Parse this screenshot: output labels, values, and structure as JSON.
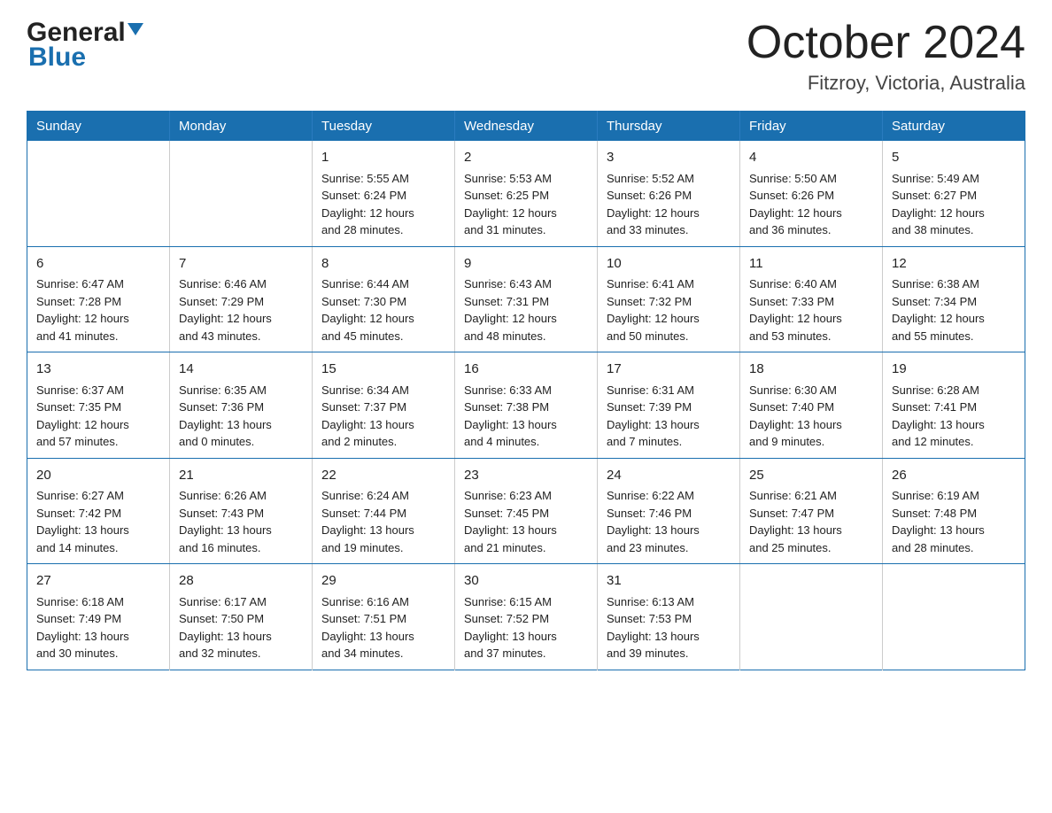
{
  "header": {
    "logo_general": "General",
    "logo_blue": "Blue",
    "month_title": "October 2024",
    "location": "Fitzroy, Victoria, Australia"
  },
  "weekdays": [
    "Sunday",
    "Monday",
    "Tuesday",
    "Wednesday",
    "Thursday",
    "Friday",
    "Saturday"
  ],
  "weeks": [
    [
      {
        "day": "",
        "info": ""
      },
      {
        "day": "",
        "info": ""
      },
      {
        "day": "1",
        "info": "Sunrise: 5:55 AM\nSunset: 6:24 PM\nDaylight: 12 hours\nand 28 minutes."
      },
      {
        "day": "2",
        "info": "Sunrise: 5:53 AM\nSunset: 6:25 PM\nDaylight: 12 hours\nand 31 minutes."
      },
      {
        "day": "3",
        "info": "Sunrise: 5:52 AM\nSunset: 6:26 PM\nDaylight: 12 hours\nand 33 minutes."
      },
      {
        "day": "4",
        "info": "Sunrise: 5:50 AM\nSunset: 6:26 PM\nDaylight: 12 hours\nand 36 minutes."
      },
      {
        "day": "5",
        "info": "Sunrise: 5:49 AM\nSunset: 6:27 PM\nDaylight: 12 hours\nand 38 minutes."
      }
    ],
    [
      {
        "day": "6",
        "info": "Sunrise: 6:47 AM\nSunset: 7:28 PM\nDaylight: 12 hours\nand 41 minutes."
      },
      {
        "day": "7",
        "info": "Sunrise: 6:46 AM\nSunset: 7:29 PM\nDaylight: 12 hours\nand 43 minutes."
      },
      {
        "day": "8",
        "info": "Sunrise: 6:44 AM\nSunset: 7:30 PM\nDaylight: 12 hours\nand 45 minutes."
      },
      {
        "day": "9",
        "info": "Sunrise: 6:43 AM\nSunset: 7:31 PM\nDaylight: 12 hours\nand 48 minutes."
      },
      {
        "day": "10",
        "info": "Sunrise: 6:41 AM\nSunset: 7:32 PM\nDaylight: 12 hours\nand 50 minutes."
      },
      {
        "day": "11",
        "info": "Sunrise: 6:40 AM\nSunset: 7:33 PM\nDaylight: 12 hours\nand 53 minutes."
      },
      {
        "day": "12",
        "info": "Sunrise: 6:38 AM\nSunset: 7:34 PM\nDaylight: 12 hours\nand 55 minutes."
      }
    ],
    [
      {
        "day": "13",
        "info": "Sunrise: 6:37 AM\nSunset: 7:35 PM\nDaylight: 12 hours\nand 57 minutes."
      },
      {
        "day": "14",
        "info": "Sunrise: 6:35 AM\nSunset: 7:36 PM\nDaylight: 13 hours\nand 0 minutes."
      },
      {
        "day": "15",
        "info": "Sunrise: 6:34 AM\nSunset: 7:37 PM\nDaylight: 13 hours\nand 2 minutes."
      },
      {
        "day": "16",
        "info": "Sunrise: 6:33 AM\nSunset: 7:38 PM\nDaylight: 13 hours\nand 4 minutes."
      },
      {
        "day": "17",
        "info": "Sunrise: 6:31 AM\nSunset: 7:39 PM\nDaylight: 13 hours\nand 7 minutes."
      },
      {
        "day": "18",
        "info": "Sunrise: 6:30 AM\nSunset: 7:40 PM\nDaylight: 13 hours\nand 9 minutes."
      },
      {
        "day": "19",
        "info": "Sunrise: 6:28 AM\nSunset: 7:41 PM\nDaylight: 13 hours\nand 12 minutes."
      }
    ],
    [
      {
        "day": "20",
        "info": "Sunrise: 6:27 AM\nSunset: 7:42 PM\nDaylight: 13 hours\nand 14 minutes."
      },
      {
        "day": "21",
        "info": "Sunrise: 6:26 AM\nSunset: 7:43 PM\nDaylight: 13 hours\nand 16 minutes."
      },
      {
        "day": "22",
        "info": "Sunrise: 6:24 AM\nSunset: 7:44 PM\nDaylight: 13 hours\nand 19 minutes."
      },
      {
        "day": "23",
        "info": "Sunrise: 6:23 AM\nSunset: 7:45 PM\nDaylight: 13 hours\nand 21 minutes."
      },
      {
        "day": "24",
        "info": "Sunrise: 6:22 AM\nSunset: 7:46 PM\nDaylight: 13 hours\nand 23 minutes."
      },
      {
        "day": "25",
        "info": "Sunrise: 6:21 AM\nSunset: 7:47 PM\nDaylight: 13 hours\nand 25 minutes."
      },
      {
        "day": "26",
        "info": "Sunrise: 6:19 AM\nSunset: 7:48 PM\nDaylight: 13 hours\nand 28 minutes."
      }
    ],
    [
      {
        "day": "27",
        "info": "Sunrise: 6:18 AM\nSunset: 7:49 PM\nDaylight: 13 hours\nand 30 minutes."
      },
      {
        "day": "28",
        "info": "Sunrise: 6:17 AM\nSunset: 7:50 PM\nDaylight: 13 hours\nand 32 minutes."
      },
      {
        "day": "29",
        "info": "Sunrise: 6:16 AM\nSunset: 7:51 PM\nDaylight: 13 hours\nand 34 minutes."
      },
      {
        "day": "30",
        "info": "Sunrise: 6:15 AM\nSunset: 7:52 PM\nDaylight: 13 hours\nand 37 minutes."
      },
      {
        "day": "31",
        "info": "Sunrise: 6:13 AM\nSunset: 7:53 PM\nDaylight: 13 hours\nand 39 minutes."
      },
      {
        "day": "",
        "info": ""
      },
      {
        "day": "",
        "info": ""
      }
    ]
  ]
}
